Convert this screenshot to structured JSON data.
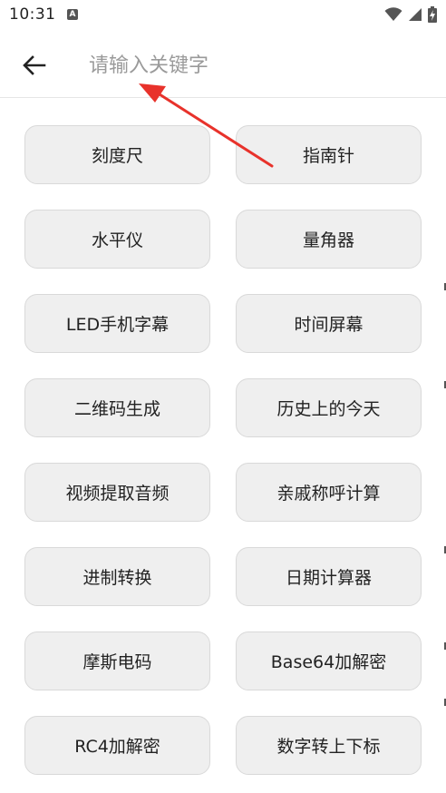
{
  "status_bar": {
    "time": "10:31",
    "notification_icon_letter": "A"
  },
  "search": {
    "placeholder": "请输入关键字",
    "value": ""
  },
  "tools": [
    {
      "label": "刻度尺"
    },
    {
      "label": "指南针"
    },
    {
      "label": "水平仪"
    },
    {
      "label": "量角器"
    },
    {
      "label": "LED手机字幕"
    },
    {
      "label": "时间屏幕"
    },
    {
      "label": "二维码生成"
    },
    {
      "label": "历史上的今天"
    },
    {
      "label": "视频提取音频"
    },
    {
      "label": "亲戚称呼计算"
    },
    {
      "label": "进制转换"
    },
    {
      "label": "日期计算器"
    },
    {
      "label": "摩斯电码"
    },
    {
      "label": "Base64加解密"
    },
    {
      "label": "RC4加解密"
    },
    {
      "label": "数字转上下标"
    }
  ],
  "colors": {
    "button_bg": "#efefef",
    "button_border": "#d9d9d9",
    "annotation_arrow": "#e8322b",
    "placeholder": "#9a9a9a"
  },
  "icons": {
    "back": "arrow-left-icon",
    "wifi": "wifi-icon",
    "signal": "cell-signal-icon",
    "battery": "battery-charging-icon"
  }
}
